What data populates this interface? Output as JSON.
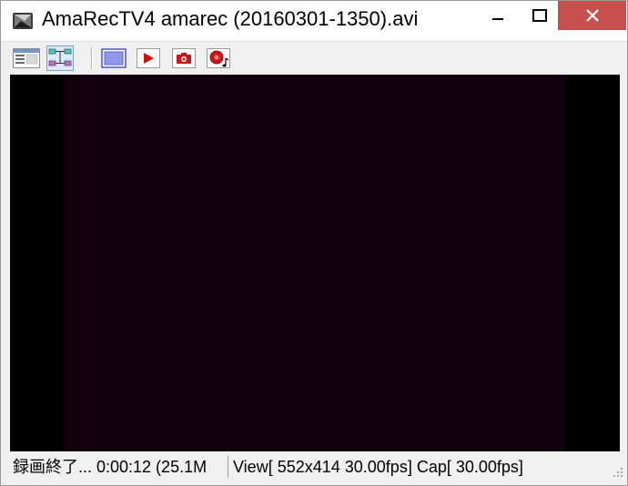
{
  "window": {
    "title": "AmaRecTV4  amarec (20160301-1350).avi",
    "minimize_icon": "minimize-icon",
    "maximize_icon": "maximize-icon",
    "close_icon": "close-icon",
    "close_color": "#c7504f"
  },
  "toolbar": {
    "buttons": [
      {
        "id": "settings",
        "icon": "window-settings-icon"
      },
      {
        "id": "graph",
        "icon": "filter-graph-icon",
        "pressed": true
      },
      {
        "id": "fullscreen",
        "icon": "screen-icon"
      },
      {
        "id": "play",
        "icon": "play-icon"
      },
      {
        "id": "snapshot",
        "icon": "camera-icon"
      },
      {
        "id": "record",
        "icon": "record-icon"
      }
    ]
  },
  "video": {
    "letterbox_color": "#000000",
    "frame_color": "#12000f"
  },
  "status": {
    "left": "録画終了... 0:00:12 (25.1M",
    "right": "View[ 552x414 30.00fps]   Cap[ 30.00fps]"
  }
}
